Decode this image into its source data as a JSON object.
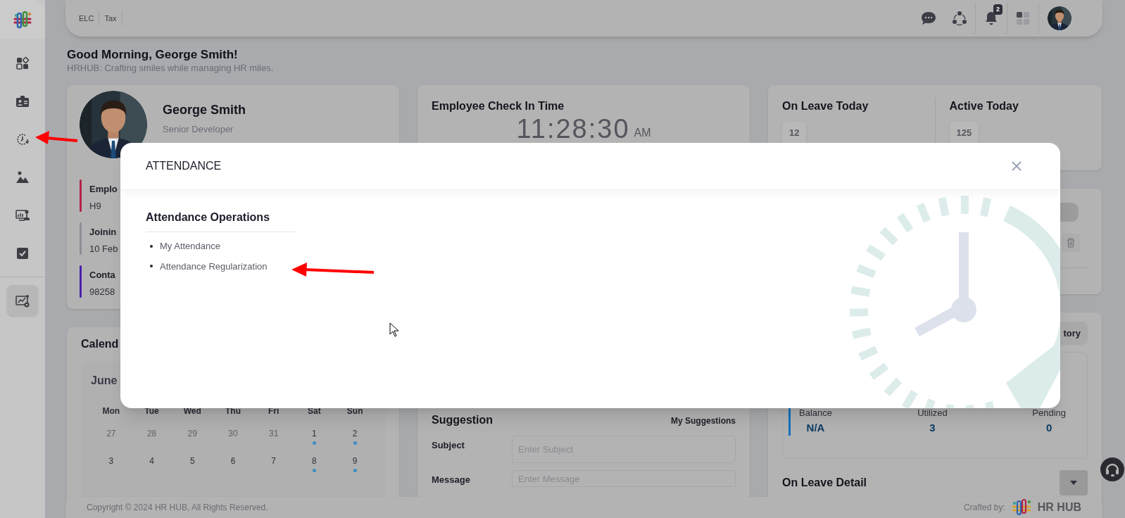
{
  "sidebar": {
    "items": [
      {
        "kind": "dashboard",
        "selected": false
      },
      {
        "kind": "id-card",
        "selected": false
      },
      {
        "kind": "attendance",
        "selected": false
      },
      {
        "kind": "gallery",
        "selected": false
      },
      {
        "kind": "monitor",
        "selected": false
      },
      {
        "kind": "tasks",
        "selected": false
      }
    ],
    "bottom_items": [
      {
        "kind": "report",
        "selected": true
      }
    ]
  },
  "header": {
    "links": [
      "ELC",
      "Tax"
    ],
    "notification_count": "2"
  },
  "greeting": {
    "title": "Good Morning, George Smith!",
    "subtitle": "HRHUB: Crafting smiles while managing HR miles."
  },
  "profile": {
    "name": "George Smith",
    "role": "Senior Developer",
    "details": [
      {
        "label": "Emplo",
        "value": "H9",
        "color": "#b52247"
      },
      {
        "label": "Joinin",
        "value": "10 Feb",
        "color": "#8e8e96"
      },
      {
        "label": "Conta",
        "value": "98258",
        "color": "#4a1fae"
      }
    ]
  },
  "checkin": {
    "title": "Employee Check In Time",
    "time": "11:28:30",
    "meridiem": "AM"
  },
  "today": [
    {
      "label": "On Leave Today",
      "count": "12"
    },
    {
      "label": "Active Today",
      "count": "125"
    }
  ],
  "calendar": {
    "title": "Calend",
    "month": "June",
    "weekdays": [
      "Mon",
      "Tue",
      "Wed",
      "Thu",
      "Fri",
      "Sat",
      "Sun"
    ],
    "days": [
      {
        "label": "27",
        "muted": true,
        "event": false
      },
      {
        "label": "28",
        "muted": true,
        "event": false
      },
      {
        "label": "29",
        "muted": true,
        "event": false
      },
      {
        "label": "30",
        "muted": true,
        "event": false
      },
      {
        "label": "31",
        "muted": true,
        "event": false
      },
      {
        "label": "1",
        "muted": false,
        "event": true
      },
      {
        "label": "2",
        "muted": false,
        "event": true
      },
      {
        "label": "3",
        "muted": false,
        "event": false
      },
      {
        "label": "4",
        "muted": false,
        "event": false
      },
      {
        "label": "5",
        "muted": false,
        "event": false
      },
      {
        "label": "6",
        "muted": false,
        "event": false
      },
      {
        "label": "7",
        "muted": false,
        "event": false
      },
      {
        "label": "8",
        "muted": false,
        "event": true
      },
      {
        "label": "9",
        "muted": false,
        "event": true
      }
    ]
  },
  "suggestion": {
    "title": "Suggestion",
    "link": "My Suggestions",
    "fields": [
      {
        "label": "Subject",
        "placeholder": "Enter Subject"
      },
      {
        "label": "Message",
        "placeholder": "Enter Message"
      }
    ]
  },
  "leave_balance": {
    "button": "tory",
    "stats": [
      {
        "label": "Balance",
        "value": "N/A"
      },
      {
        "label": "Utilized",
        "value": "3"
      },
      {
        "label": "Pending",
        "value": "0"
      }
    ]
  },
  "on_leave_detail": {
    "title": "On Leave Detail"
  },
  "footer": {
    "copyright": "Copyright © 2024 HR HUB, All Rights Reserved.",
    "crafted_by": "Crafted by:",
    "brand": "HR HUB"
  },
  "modal": {
    "title": "ATTENDANCE",
    "section": "Attendance Operations",
    "items": [
      "My Attendance",
      "Attendance Regularization"
    ]
  }
}
